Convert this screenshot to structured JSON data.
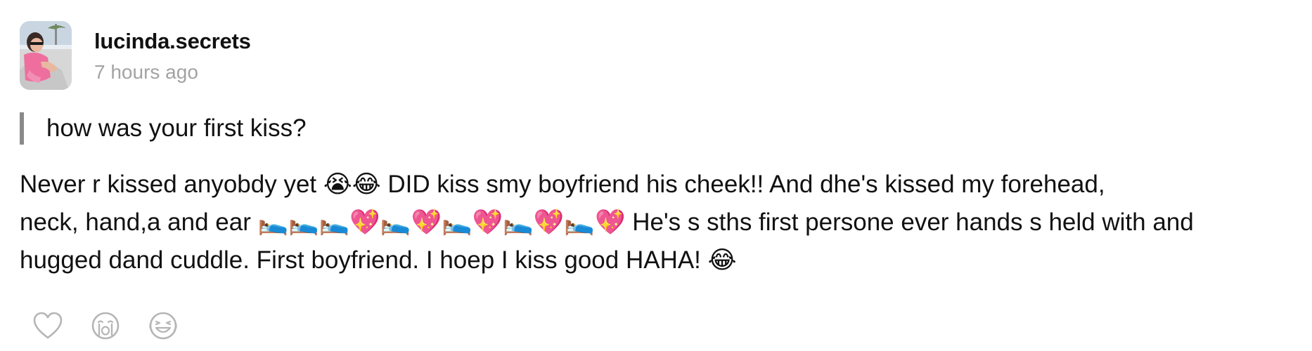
{
  "post": {
    "author": {
      "username": "lucinda.secrets",
      "timestamp": "7 hours ago"
    },
    "question": "how was your first kiss?",
    "answer_lines": [
      "Never r kissed anyobdy yet 😭😂 DID kiss smy boyfriend his cheek!! And dhe's kissed my forehead,",
      "neck, hand,a and ear 🛌🛌🛌💖🛌💖🛌💖🛌💖🛌💖 He's s sths first persone ever hands s held with and",
      "hugged dand cuddle. First boyfriend.  I hoep I kiss good HAHA! 😂"
    ]
  },
  "reactions": [
    {
      "icon": "heart-outline-icon"
    },
    {
      "icon": "crying-face-icon"
    },
    {
      "icon": "laughing-face-icon"
    }
  ],
  "colors": {
    "text": "#111111",
    "muted": "#a3a3a3",
    "quote_bar": "#8a8a8a",
    "icon_gray": "#b5b5b5"
  }
}
